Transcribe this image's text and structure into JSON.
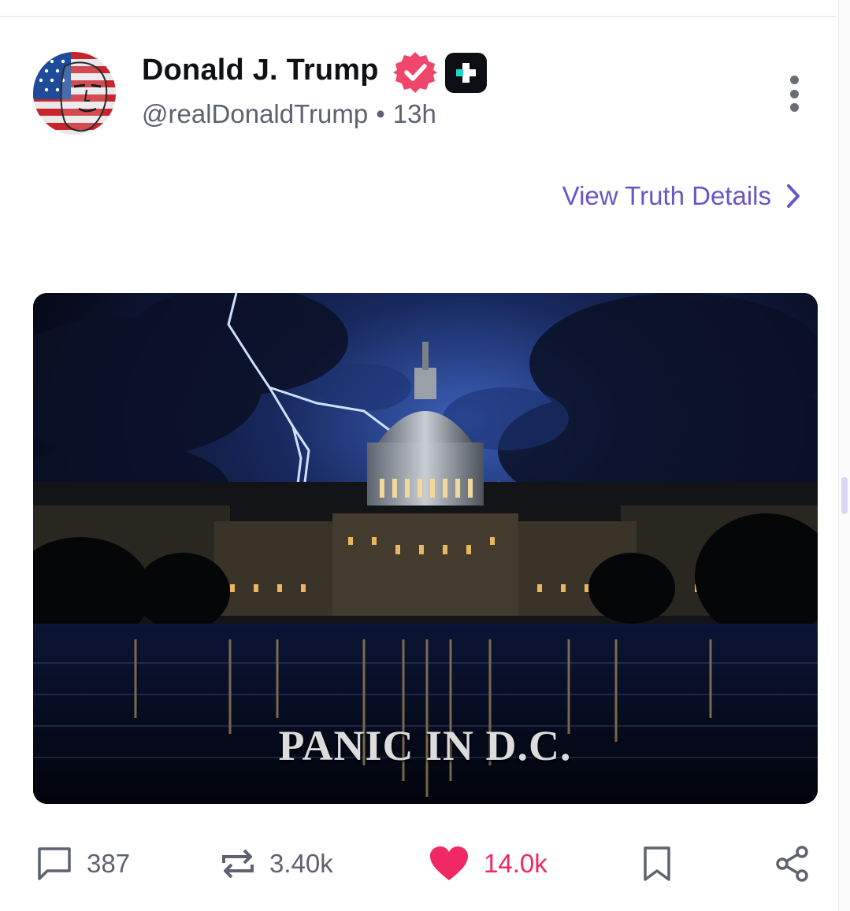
{
  "post": {
    "author": {
      "display_name": "Donald J. Trump",
      "handle": "@realDonaldTrump",
      "verified_icon": "verified-badge-icon",
      "verified_color": "#f0466b",
      "plus_icon": "plus-badge-icon"
    },
    "separator": "•",
    "timestamp": "13h",
    "details_link": "View Truth Details",
    "media": {
      "caption": "PANIC IN D.C."
    },
    "actions": {
      "replies": "387",
      "retruths": "3.40k",
      "likes": "14.0k",
      "like_color": "#f02863",
      "accent_color": "#6a55c8"
    }
  }
}
